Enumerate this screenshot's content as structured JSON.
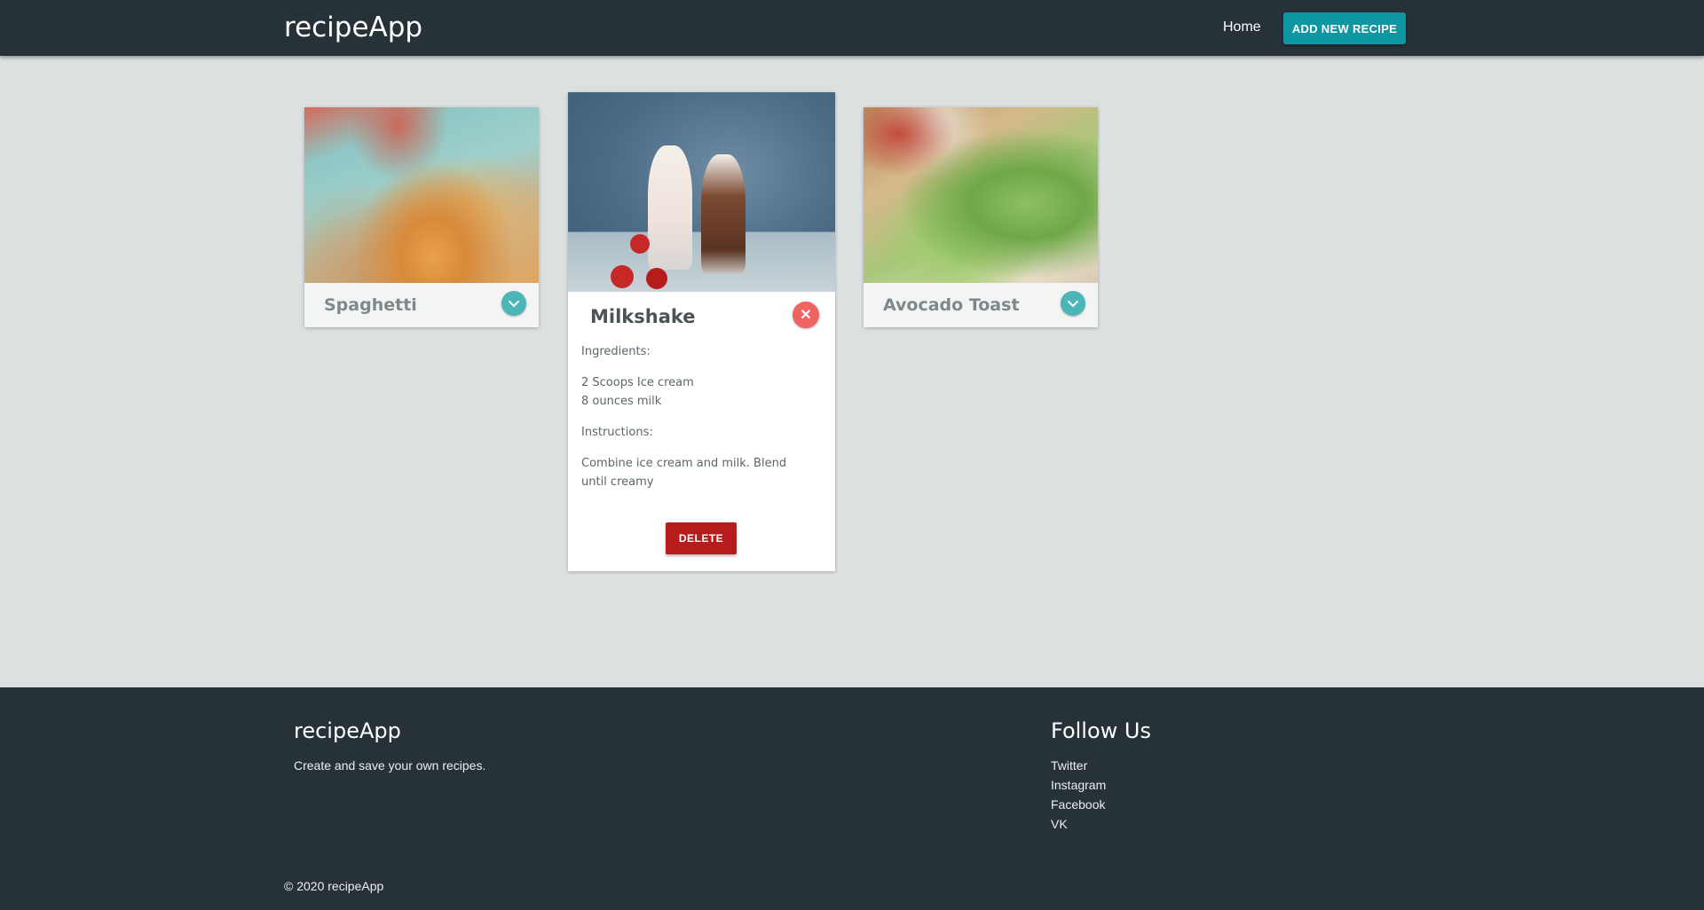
{
  "navbar": {
    "brand": "recipeApp",
    "home": "Home",
    "add_recipe": "ADD NEW RECIPE"
  },
  "recipes": [
    {
      "title": "Spaghetti",
      "image": "spaghetti-photo",
      "expanded": false
    },
    {
      "title": "Milkshake",
      "image": "milkshake-photo",
      "expanded": true,
      "ingredients_label": "Ingredients:",
      "ingredients": [
        "2 Scoops Ice cream",
        "8 ounces milk"
      ],
      "instructions_label": "Instructions:",
      "instructions": "Combine ice cream and milk. Blend until creamy",
      "close_icon": "✕",
      "delete_label": "DELETE"
    },
    {
      "title": "Avocado Toast",
      "image": "avocado-toast-photo",
      "expanded": false
    }
  ],
  "footer": {
    "brand": "recipeApp",
    "tagline": "Create and save your own recipes.",
    "follow_title": "Follow Us",
    "social": [
      "Twitter",
      "Instagram",
      "Facebook",
      "VK"
    ],
    "copyright": "© 2020 recipeApp"
  },
  "colors": {
    "navbar_bg": "#263238",
    "accent": "#0e97a3",
    "expand_button": "#4bb5b7",
    "close_button": "#ef6461",
    "delete_button": "#b71c1c",
    "page_bg": "#dde0e0"
  }
}
